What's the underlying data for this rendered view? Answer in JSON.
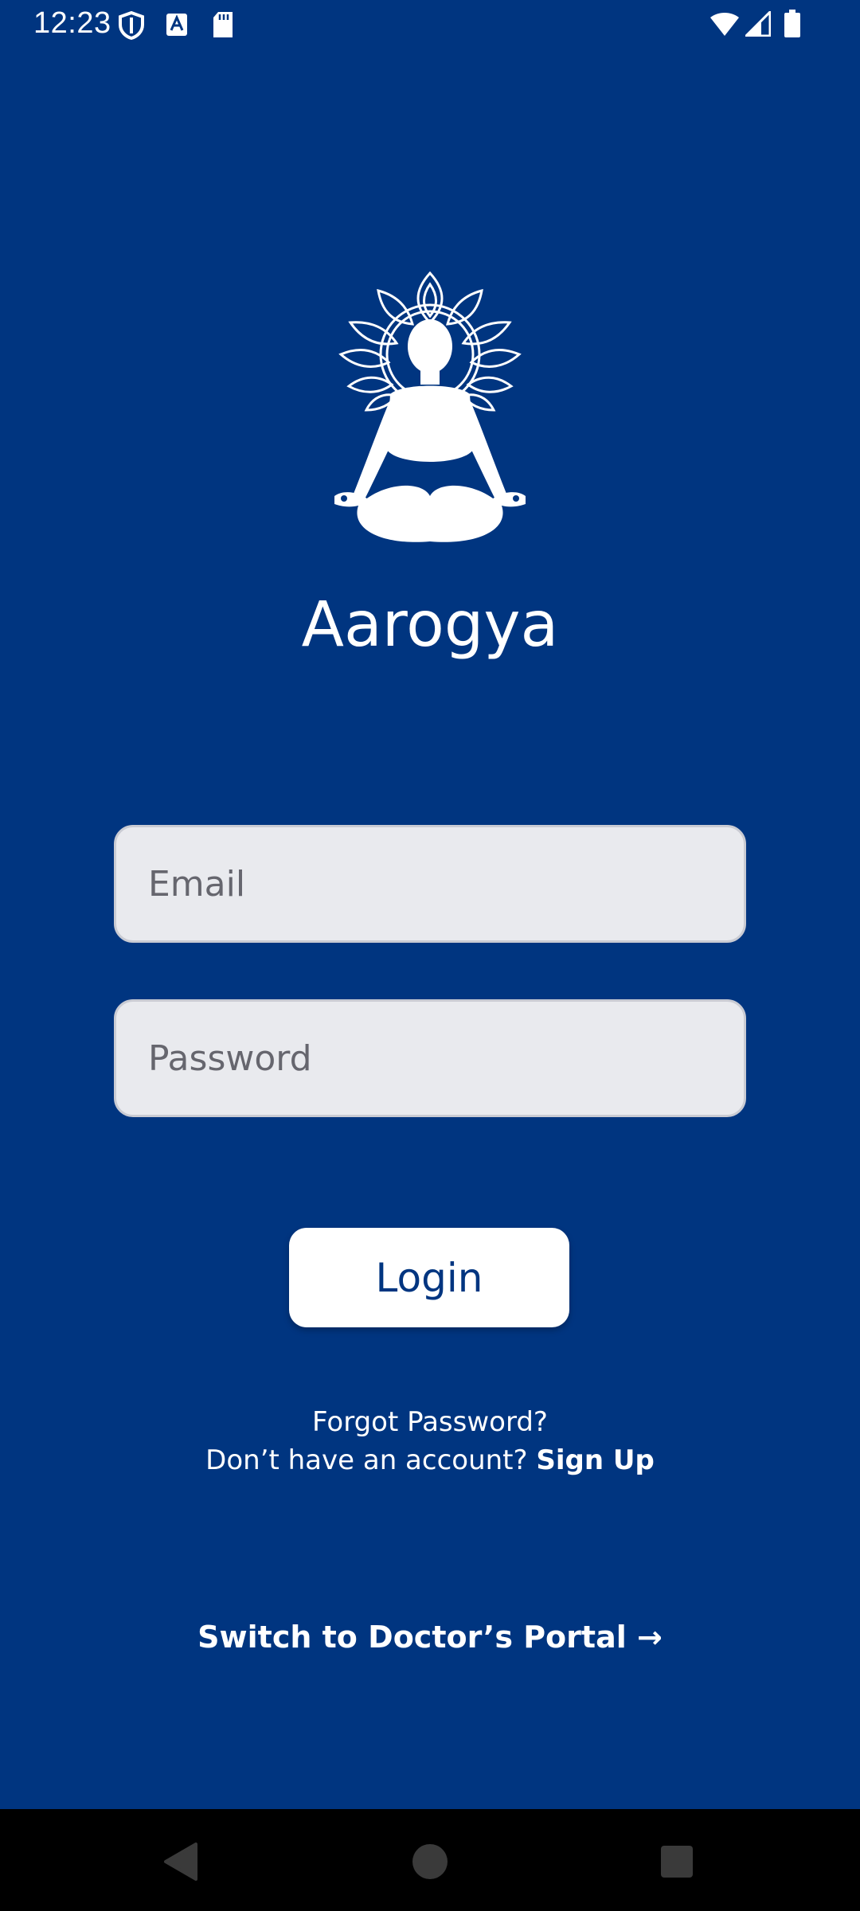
{
  "status_bar": {
    "time": "12:23",
    "icons": [
      "shield-icon",
      "keyboard-a-icon",
      "sd-card-icon",
      "wifi-icon",
      "signal-icon",
      "battery-icon"
    ]
  },
  "app": {
    "name": "Aarogya",
    "logo": "meditation-figure-logo"
  },
  "form": {
    "email_placeholder": "Email",
    "email_value": "",
    "password_placeholder": "Password",
    "password_value": "",
    "login_label": "Login"
  },
  "links": {
    "forgot_password": "Forgot Password?",
    "no_account": "Don’t have an account?",
    "sign_up": "Sign Up",
    "doctor_portal": "Switch to Doctor’s Portal",
    "doctor_portal_arrow": "→"
  },
  "nav": {
    "back": "back-triangle-icon",
    "home": "home-circle-icon",
    "recents": "recents-square-icon"
  },
  "colors": {
    "background": "#003580",
    "field_bg": "#e9eaee",
    "button_bg": "#ffffff",
    "button_text": "#003580"
  }
}
